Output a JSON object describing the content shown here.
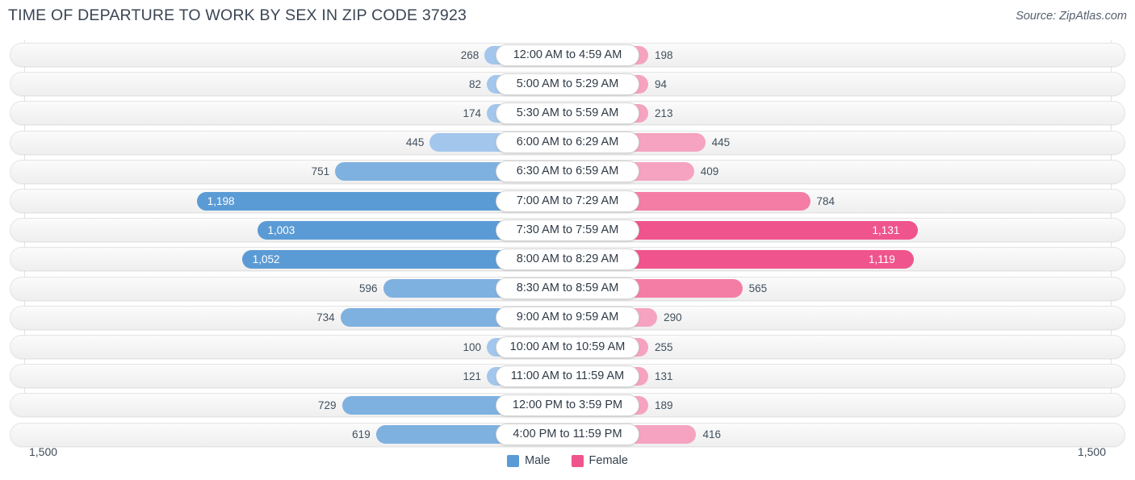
{
  "header": {
    "title": "TIME OF DEPARTURE TO WORK BY SEX IN ZIP CODE 37923",
    "source": "Source: ZipAtlas.com"
  },
  "axis": {
    "left_label": "1,500",
    "right_label": "1,500"
  },
  "legend": {
    "items": [
      {
        "label": "Male",
        "color": "#5b9bd5"
      },
      {
        "label": "Female",
        "color": "#f0548c"
      }
    ]
  },
  "chart_data": {
    "type": "bar",
    "orientation": "horizontal-diverging",
    "title": "TIME OF DEPARTURE TO WORK BY SEX IN ZIP CODE 37923",
    "xlabel": "",
    "ylabel": "",
    "xlim": [
      -1500,
      1500
    ],
    "axis_max": 1500,
    "grid": false,
    "legend_position": "bottom-center",
    "categories": [
      "12:00 AM to 4:59 AM",
      "5:00 AM to 5:29 AM",
      "5:30 AM to 5:59 AM",
      "6:00 AM to 6:29 AM",
      "6:30 AM to 6:59 AM",
      "7:00 AM to 7:29 AM",
      "7:30 AM to 7:59 AM",
      "8:00 AM to 8:29 AM",
      "8:30 AM to 8:59 AM",
      "9:00 AM to 9:59 AM",
      "10:00 AM to 10:59 AM",
      "11:00 AM to 11:59 AM",
      "12:00 PM to 3:59 PM",
      "4:00 PM to 11:59 PM"
    ],
    "series": [
      {
        "name": "Male",
        "color": "#5b9bd5",
        "side": "left",
        "values": [
          268,
          82,
          174,
          445,
          751,
          1198,
          1003,
          1052,
          596,
          734,
          100,
          121,
          729,
          619
        ],
        "labels": [
          "268",
          "82",
          "174",
          "445",
          "751",
          "1,198",
          "1,003",
          "1,052",
          "596",
          "734",
          "100",
          "121",
          "729",
          "619"
        ]
      },
      {
        "name": "Female",
        "color": "#f0548c",
        "side": "right",
        "values": [
          198,
          94,
          213,
          445,
          409,
          784,
          1131,
          1119,
          565,
          290,
          255,
          131,
          189,
          416
        ],
        "labels": [
          "198",
          "94",
          "213",
          "445",
          "409",
          "784",
          "1,131",
          "1,119",
          "565",
          "290",
          "255",
          "131",
          "189",
          "416"
        ]
      }
    ]
  }
}
